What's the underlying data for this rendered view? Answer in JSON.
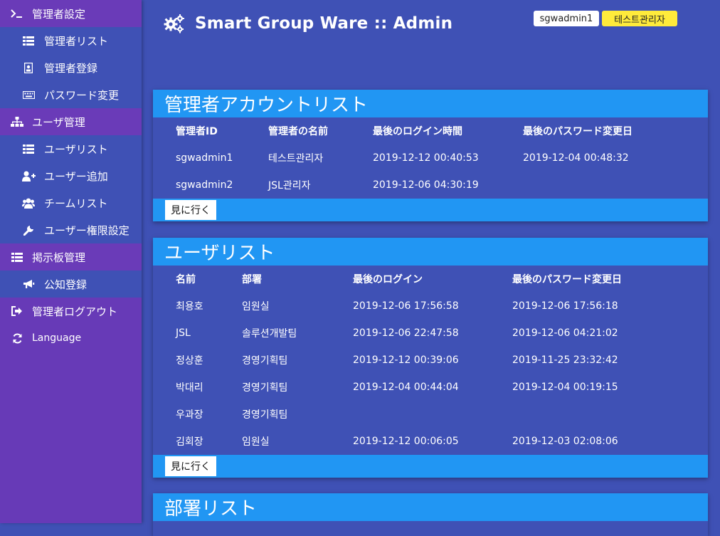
{
  "sidebar": {
    "items": [
      {
        "label": "管理者設定",
        "icon": "terminal-icon"
      },
      {
        "label": "管理者リスト",
        "icon": "list-icon"
      },
      {
        "label": "管理者登録",
        "icon": "id-card-icon"
      },
      {
        "label": "パスワード変更",
        "icon": "keyboard-icon"
      },
      {
        "label": "ユーザ管理",
        "icon": "sitemap-icon"
      },
      {
        "label": "ユーザリスト",
        "icon": "list-icon"
      },
      {
        "label": "ユーザー追加",
        "icon": "user-plus-icon"
      },
      {
        "label": "チームリスト",
        "icon": "users-icon"
      },
      {
        "label": "ユーザー権限設定",
        "icon": "wrench-icon"
      },
      {
        "label": "掲示板管理",
        "icon": "list-icon"
      },
      {
        "label": "公知登録",
        "icon": "bullhorn-icon"
      },
      {
        "label": "管理者ログアウト",
        "icon": "sign-out-icon"
      },
      {
        "label": "Language",
        "icon": "refresh-icon"
      }
    ]
  },
  "header": {
    "title": "Smart Group Ware :: Admin",
    "icon": "gears-icon",
    "user_id": "sgwadmin1",
    "user_name": "테스트관리자"
  },
  "admin_panel": {
    "title": "管理者アカウントリスト",
    "columns": [
      "管理者ID",
      "管理者の名前",
      "最後のログイン時間",
      "最後のパスワード変更日"
    ],
    "rows": [
      [
        "sgwadmin1",
        "테스트관리자",
        "2019-12-12 00:40:53",
        "2019-12-04 00:48:32"
      ],
      [
        "sgwadmin2",
        "JSL관리자",
        "2019-12-06 04:30:19",
        ""
      ]
    ],
    "button_label": "見に行く"
  },
  "user_panel": {
    "title": "ユーザリスト",
    "columns": [
      "名前",
      "部署",
      "最後のログイン",
      "最後のパスワード変更日"
    ],
    "rows": [
      [
        "최용호",
        "임원실",
        "2019-12-06 17:56:58",
        "2019-12-06 17:56:18"
      ],
      [
        "JSL",
        "솔루션개발팀",
        "2019-12-06 22:47:58",
        "2019-12-06 04:21:02"
      ],
      [
        "정상훈",
        "경영기획팀",
        "2019-12-12 00:39:06",
        "2019-11-25 23:32:42"
      ],
      [
        "박대리",
        "경영기획팀",
        "2019-12-04 00:44:04",
        "2019-12-04 00:19:15"
      ],
      [
        "우과장",
        "경영기획팀",
        "",
        ""
      ],
      [
        "김회장",
        "임원실",
        "2019-12-12 00:06:05",
        "2019-12-03 02:08:06"
      ]
    ],
    "button_label": "見に行く"
  },
  "dept_panel": {
    "title": "部署リスト"
  },
  "colors": {
    "background": "#3f51b5",
    "sidebar": "#673ab7",
    "panel_header": "#2196f3",
    "badge_name": "#ffeb3b"
  }
}
